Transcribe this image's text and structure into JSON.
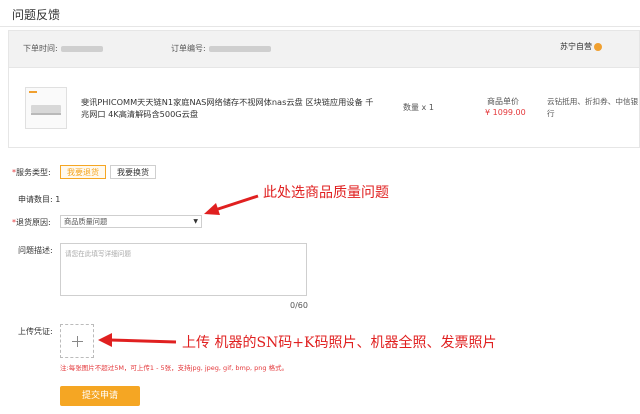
{
  "page": {
    "title": "问题反馈"
  },
  "order": {
    "order_time_label": "下单时间:",
    "order_number_label": "订单编号:",
    "store_name": "苏宁自营"
  },
  "product": {
    "name": "斐讯PHICOMM天天链N1家庭NAS网络储存不视网体nas云盘 区块链应用设备 千兆网口 4K高清解码含500G云盘",
    "quantity": "数量 x 1",
    "price_label": "商品单价",
    "price": "¥ 1099.00",
    "payment_methods": "云钻抵用、折扣券、中信银行"
  },
  "form": {
    "service_type_label": "服务类型:",
    "service_options": [
      "我要退货",
      "我要换货"
    ],
    "apply_count_label": "申请数目:",
    "apply_count_value": "1",
    "reason_label": "退货原因:",
    "reason_selected": "商品质量问题",
    "description_label": "问题描述:",
    "description_placeholder": "请您在此填写详细问题",
    "char_counter": "0/60",
    "upload_label": "上传凭证:",
    "upload_hint": "注:每张图片不超过5M，可上传1 - 5张，支持jpg, jpeg, gif, bmp, png 格式。",
    "submit_label": "提交申请"
  },
  "annotations": {
    "reason_note": "此处选商品质量问题",
    "upload_note": "上传 机器的SN码+K码照片、机器全照、发票照片"
  },
  "colors": {
    "accent": "#f5a623",
    "price_red": "#e4393c",
    "annotation_red": "#e02020"
  }
}
